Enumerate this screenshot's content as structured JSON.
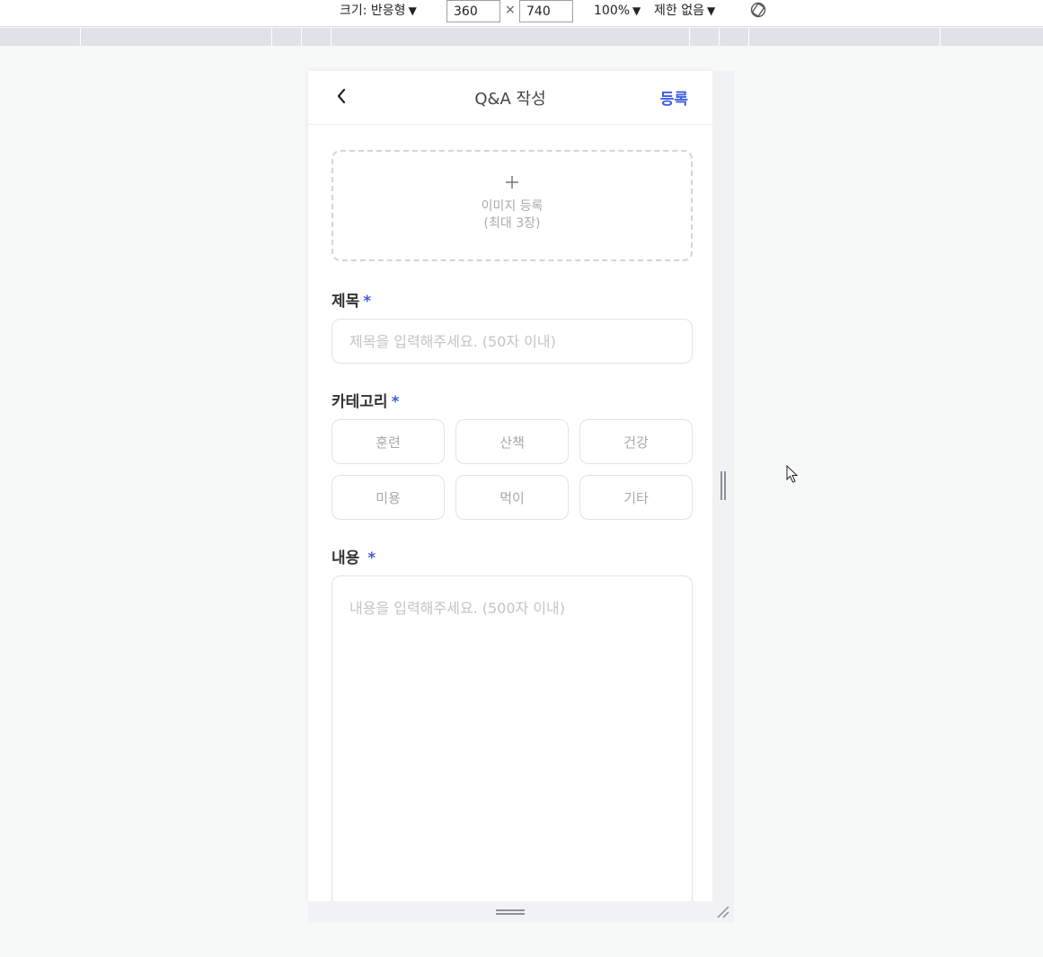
{
  "devtools": {
    "size_label": "크기: 반응형",
    "width_value": "360",
    "height_value": "740",
    "times": "×",
    "zoom_label": "100%",
    "throttle_label": "제한 없음",
    "caret": "▼",
    "rotate_icon": "rotate-icon"
  },
  "header": {
    "back_icon": "chevron-left-icon",
    "title": "Q&A 작성",
    "submit_label": "등록"
  },
  "image_upload": {
    "icon": "plus-icon",
    "label_line1": "이미지 등록",
    "label_line2": "(최대 3장)"
  },
  "form": {
    "title_label": "제목",
    "required_mark": "*",
    "title_placeholder": "제목을 입력해주세요. (50자 이내)",
    "category_label": "카테고리",
    "categories": [
      "훈련",
      "산책",
      "건강",
      "미용",
      "먹이",
      "기타"
    ],
    "content_label": "내용",
    "content_placeholder": "내용을 입력해주세요. (500자 이내)"
  },
  "colors": {
    "accent": "#3b5ee0",
    "placeholder": "#c4c4c4",
    "border": "#e2e2e2"
  }
}
